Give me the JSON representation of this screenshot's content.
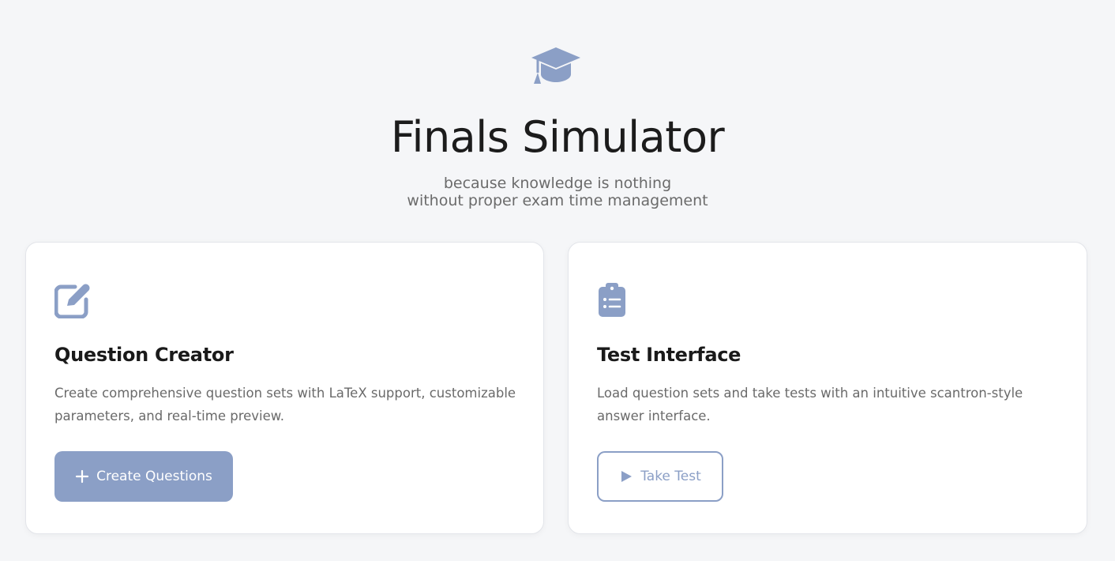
{
  "hero": {
    "icon": "graduation-cap-icon",
    "title": "Finals Simulator",
    "subtitle_line1": "because knowledge is nothing",
    "subtitle_line2": "without proper exam time management"
  },
  "cards": [
    {
      "icon": "edit-icon",
      "title": "Question Creator",
      "description": "Create comprehensive question sets with LaTeX support, customizable parameters, and real-time preview.",
      "button_icon": "plus-icon",
      "button_label": "Create Questions"
    },
    {
      "icon": "clipboard-list-icon",
      "title": "Test Interface",
      "description": "Load question sets and take tests with an intuitive scantron-style answer interface.",
      "button_icon": "play-icon",
      "button_label": "Take Test"
    }
  ],
  "colors": {
    "accent": "#8b9fc6",
    "background": "#f5f6f8",
    "card": "#ffffff",
    "title_text": "#1c1c1c",
    "muted_text": "#6b6b6b"
  }
}
